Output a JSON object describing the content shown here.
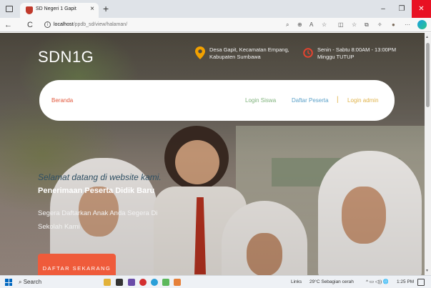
{
  "browser": {
    "tab_title": "SD Negeri 1 Gapit",
    "tab_close": "×",
    "new_tab": "+",
    "url_host": "localhost",
    "url_path": "/ppdb_sd/view/halaman/",
    "window_controls": {
      "minimize": "–",
      "maximize": "❐",
      "close": "✕"
    },
    "nav": {
      "back": "←",
      "reload": "C"
    },
    "toolbar_icons": [
      "search-icon",
      "zoom-icon",
      "read-aloud-icon",
      "favorite-icon",
      "split-screen-icon",
      "favorites-icon",
      "collections-icon",
      "extensions-icon",
      "profile-icon",
      "more-icon",
      "edge-copilot-icon"
    ],
    "toolbar_glyphs": {
      "search": "⌕",
      "zoom": "⊕",
      "read": "A",
      "fav": "☆",
      "split": "◫",
      "favs": "☆",
      "coll": "⧉",
      "ext": "✧",
      "profile": "●",
      "more": "···"
    }
  },
  "site": {
    "logo": "SDN1G",
    "location_line1": "Desa Gapit, Kecamatan Empang,",
    "location_line2": "Kabupaten Sumbawa",
    "hours_line1": "Senin - Sabtu 8:00AM - 13:00PM",
    "hours_line2": "Minggu TUTUP",
    "icon_colors": {
      "location": "#f2a100",
      "clock": "#e8432f"
    }
  },
  "nav": {
    "home": "Beranda",
    "login_siswa": "Login Siswa",
    "daftar_peserta": "Daftar Peserta",
    "separator": "|",
    "login_admin": "Login admin"
  },
  "hero": {
    "welcome": "Selamat datang di website kami.",
    "heading": "Penerimaan Peserta Didik Baru",
    "subtext": "Segera Daftarkan Anak Anda Segera Di Sekolah Kami",
    "cta": "DAFTAR SEKARANG",
    "cta_color": "#ef5b3b"
  },
  "taskbar": {
    "search": "Search",
    "links": "Links",
    "weather": "29°C  Sebagian cerah",
    "time": "1:25 PM",
    "tray_icons": "^ ▭ ◁)) 🌐"
  }
}
